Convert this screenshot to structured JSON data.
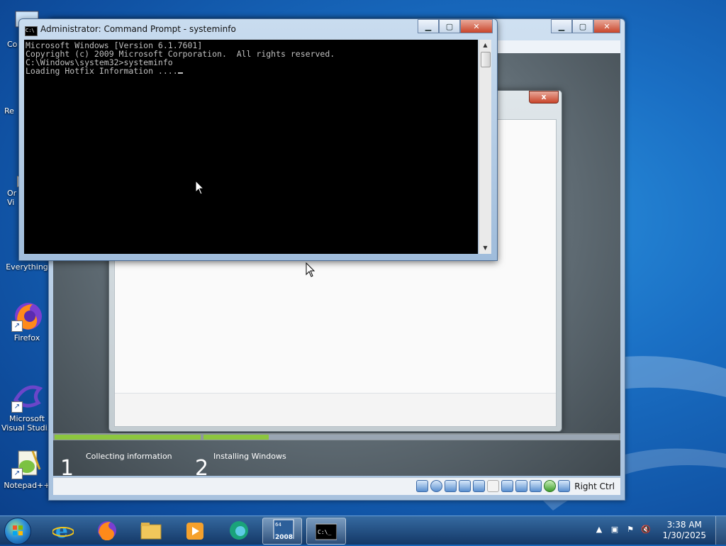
{
  "desktop": {
    "icons": [
      {
        "label": "Co",
        "icon": "computer-icon"
      },
      {
        "label": "Re",
        "icon": "recycle-bin-icon"
      },
      {
        "label": "Or\nVi",
        "icon": "oracle-virtualbox-icon"
      },
      {
        "label": "Everything",
        "icon": "everything-search-icon"
      },
      {
        "label": "Firefox",
        "icon": "firefox-icon"
      },
      {
        "label": "Microsoft\nVisual Studi...",
        "icon": "visual-studio-icon"
      },
      {
        "label": "Notepad++",
        "icon": "notepadpp-icon"
      }
    ]
  },
  "cmd": {
    "title": "Administrator: Command Prompt - systeminfo",
    "lines": [
      "Microsoft Windows [Version 6.1.7601]",
      "Copyright (c) 2009 Microsoft Corporation.  All rights reserved.",
      "",
      "C:\\Windows\\system32>systeminfo",
      "Loading Hotfix Information ...."
    ]
  },
  "setup": {
    "steps": [
      {
        "number": "1",
        "label": "Collecting information"
      },
      {
        "number": "2",
        "label": "Installing Windows"
      }
    ],
    "close_label": "x"
  },
  "vbox": {
    "host_key": "Right Ctrl"
  },
  "taskbar": {
    "apps": [
      {
        "name": "Internet Explorer",
        "icon": "internet-explorer-icon"
      },
      {
        "name": "Firefox",
        "icon": "firefox-icon"
      },
      {
        "name": "Windows Explorer",
        "icon": "folder-icon"
      },
      {
        "name": "Media Player",
        "icon": "media-player-icon"
      },
      {
        "name": "Microsoft Edge",
        "icon": "edge-icon"
      },
      {
        "name": "VirtualBox 2008",
        "icon": "vbox-2008-icon",
        "badge": "2008",
        "badge_top": "64"
      },
      {
        "name": "Command Prompt",
        "icon": "cmd-icon",
        "active": true
      }
    ],
    "clock": {
      "time": "3:38 AM",
      "date": "1/30/2025"
    }
  },
  "colors": {
    "console_bg": "#000000",
    "console_fg": "#c0c0c0",
    "progress": "#8cc63f"
  }
}
